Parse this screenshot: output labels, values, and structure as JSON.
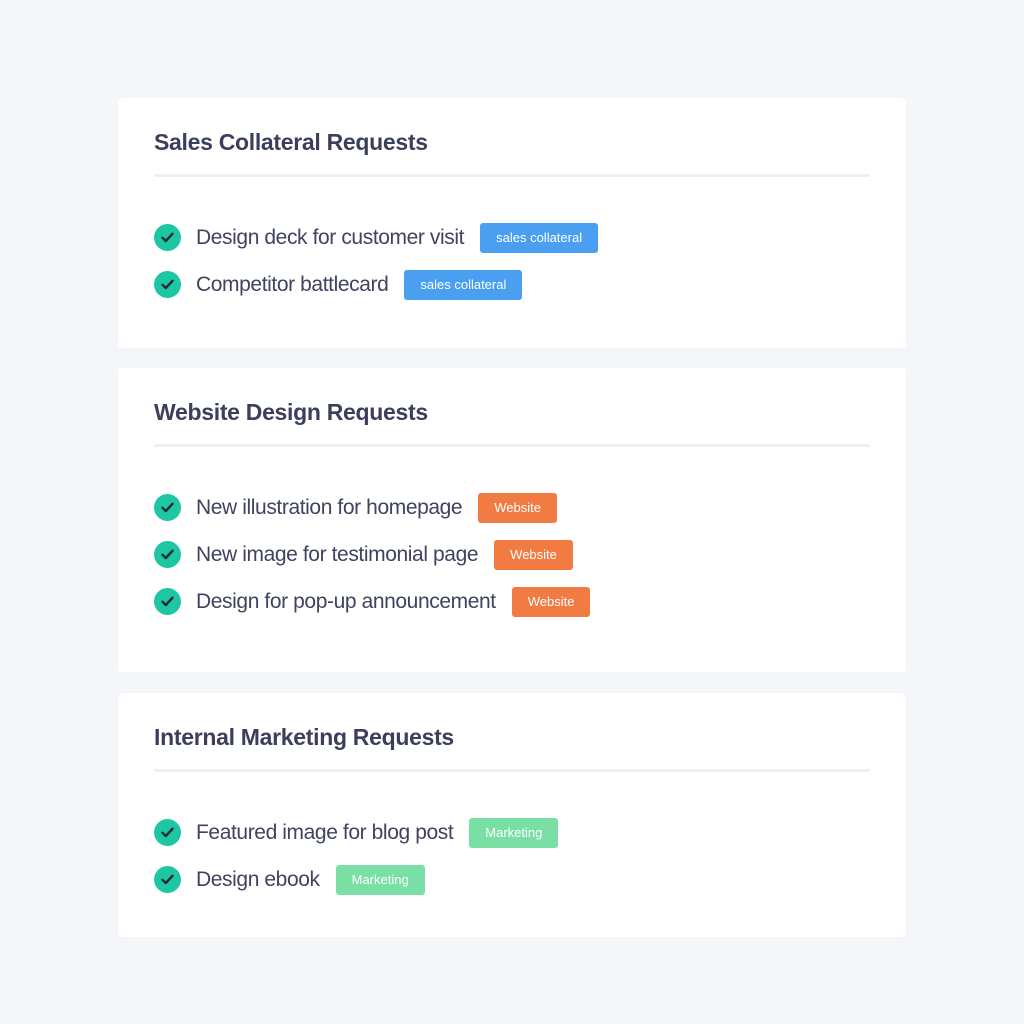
{
  "colors": {
    "page_background": "#f5f6fa",
    "card_background": "#ffffff",
    "check": "#1fc6a3",
    "tag_sales": "#4a9ff0",
    "tag_website": "#f27b43",
    "tag_marketing": "#79dfa4"
  },
  "sections": [
    {
      "title": "Sales Collateral Requests",
      "tasks": [
        {
          "label": "Design deck for customer visit",
          "tag": "sales collateral",
          "icon": "check-circle-icon"
        },
        {
          "label": "Competitor battlecard",
          "tag": "sales collateral",
          "icon": "check-circle-icon"
        }
      ]
    },
    {
      "title": "Website Design Requests",
      "tasks": [
        {
          "label": "New illustration for homepage",
          "tag": "Website",
          "icon": "check-circle-icon"
        },
        {
          "label": "New image for testimonial page",
          "tag": "Website",
          "icon": "check-circle-icon"
        },
        {
          "label": "Design for pop-up announcement",
          "tag": "Website",
          "icon": "check-circle-icon"
        }
      ]
    },
    {
      "title": "Internal Marketing Requests",
      "tasks": [
        {
          "label": "Featured image for blog post",
          "tag": "Marketing",
          "icon": "check-circle-icon"
        },
        {
          "label": "Design ebook",
          "tag": "Marketing",
          "icon": "check-circle-icon"
        }
      ]
    }
  ]
}
